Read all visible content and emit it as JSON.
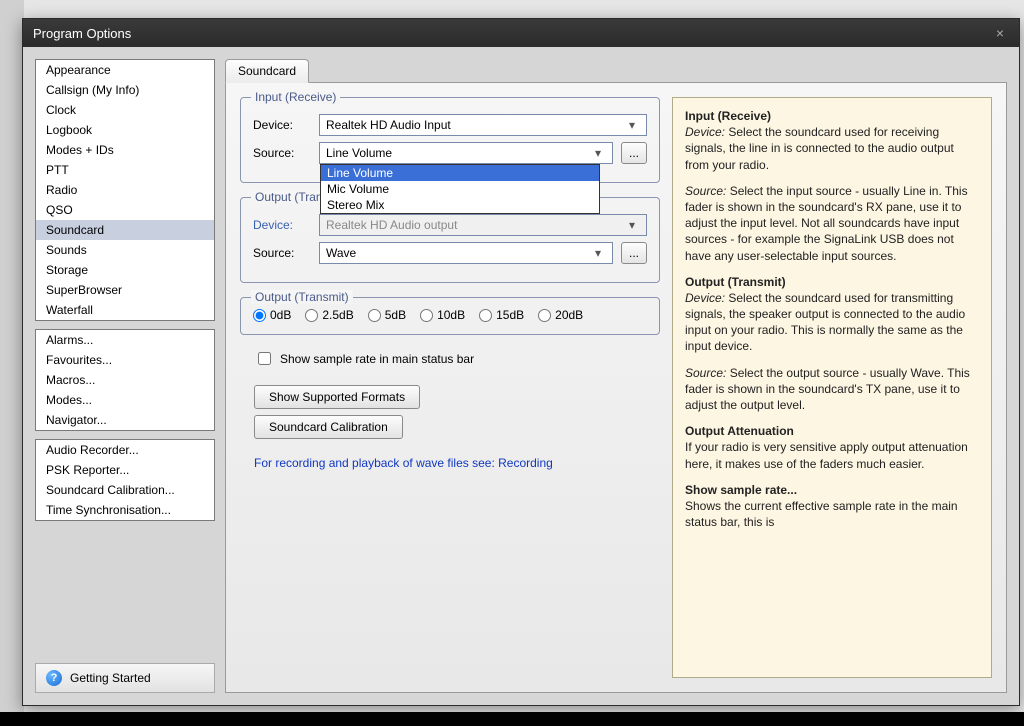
{
  "window": {
    "title": "Program Options",
    "close": "×"
  },
  "sidebar": {
    "groups": [
      {
        "items": [
          {
            "label": "Appearance"
          },
          {
            "label": "Callsign (My Info)"
          },
          {
            "label": "Clock"
          },
          {
            "label": "Logbook"
          },
          {
            "label": "Modes + IDs"
          },
          {
            "label": "PTT"
          },
          {
            "label": "Radio"
          },
          {
            "label": "QSO"
          },
          {
            "label": "Soundcard",
            "selected": true
          },
          {
            "label": "Sounds"
          },
          {
            "label": "Storage"
          },
          {
            "label": "SuperBrowser"
          },
          {
            "label": "Waterfall"
          }
        ]
      },
      {
        "items": [
          {
            "label": "Alarms..."
          },
          {
            "label": "Favourites..."
          },
          {
            "label": "Macros..."
          },
          {
            "label": "Modes..."
          },
          {
            "label": "Navigator..."
          }
        ]
      },
      {
        "items": [
          {
            "label": "Audio Recorder..."
          },
          {
            "label": "PSK Reporter..."
          },
          {
            "label": "Soundcard Calibration..."
          },
          {
            "label": "Time Synchronisation..."
          }
        ]
      }
    ],
    "getting_started": "Getting Started"
  },
  "tab": {
    "label": "Soundcard"
  },
  "input": {
    "legend": "Input (Receive)",
    "device_label": "Device:",
    "device_value": "Realtek HD Audio Input",
    "source_label": "Source:",
    "source_value": "Line Volume",
    "source_options": [
      "Line Volume",
      "Mic Volume",
      "Stereo Mix"
    ],
    "more": "..."
  },
  "output": {
    "legend": "Output (Transmit)",
    "device_label": "Device:",
    "device_value": "Realtek HD Audio output",
    "source_label": "Source:",
    "source_value": "Wave",
    "more": "..."
  },
  "atten": {
    "legend": "Output (Transmit)",
    "options": [
      "0dB",
      "2.5dB",
      "5dB",
      "10dB",
      "15dB",
      "20dB"
    ],
    "selected": "0dB"
  },
  "checkbox": {
    "label": "Show sample rate in main status bar"
  },
  "buttons": {
    "formats": "Show Supported Formats",
    "calibration": "Soundcard Calibration"
  },
  "link_text": "For recording and playback of wave files see: Recording",
  "help": {
    "h1": "Input (Receive)",
    "p1a": "Device:",
    "p1b": " Select the soundcard used for receiving signals, the line in is connected to the audio output from your radio.",
    "p2a": "Source:",
    "p2b": " Select the input source - usually Line in. This fader is shown in the soundcard's RX pane, use it to adjust the input level. Not all soundcards have input sources - for example the SignaLink USB does not have any user-selectable input sources.",
    "h2": "Output (Transmit)",
    "p3a": "Device:",
    "p3b": " Select the soundcard used for transmitting signals, the speaker output is connected to the audio input on your radio. This is normally the same as the input device.",
    "p4a": "Source:",
    "p4b": " Select the output source - usually Wave. This fader is shown in the soundcard's TX pane, use it to adjust the output level.",
    "h3": "Output Attenuation",
    "p5": "If your radio is very sensitive apply output attenuation here, it makes use of the faders much easier.",
    "h4": "Show sample rate...",
    "p6": "Shows the current effective sample rate in the main status bar, this is"
  }
}
